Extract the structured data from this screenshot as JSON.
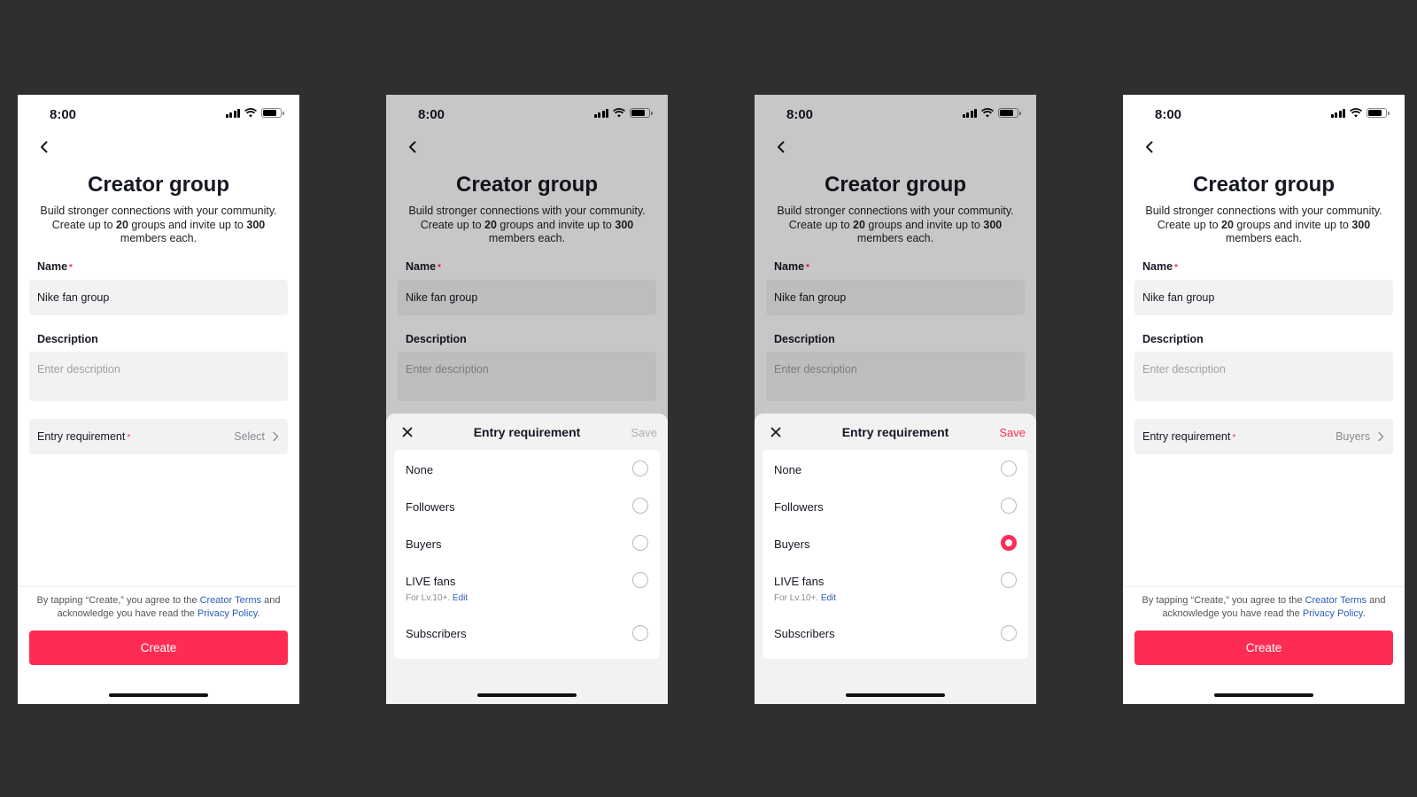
{
  "status_bar": {
    "time": "8:00"
  },
  "page": {
    "title": "Creator group",
    "subtitle_part1": "Build stronger connections with your community. Create up to ",
    "subtitle_groups": "20",
    "subtitle_part2": " groups and invite up to ",
    "subtitle_members": "300",
    "subtitle_part3": " members each.",
    "name_label": "Name",
    "name_value": "Nike fan group",
    "description_label": "Description",
    "description_placeholder": "Enter description",
    "entry_label": "Entry requirement",
    "required_mark": "*"
  },
  "screens": {
    "s1": {
      "entry_value": "Select"
    },
    "s4": {
      "entry_value": "Buyers"
    }
  },
  "footer": {
    "legal_part1": "By tapping “Create,” you agree to the ",
    "creator_terms": "Creator Terms",
    "legal_part2": " and acknowledge you have read the ",
    "privacy_policy": "Privacy Policy",
    "legal_part3": ".",
    "create_label": "Create"
  },
  "sheet": {
    "title": "Entry requirement",
    "save_label": "Save",
    "options": [
      "None",
      "Followers",
      "Buyers",
      "LIVE fans",
      "Subscribers"
    ],
    "live_fans_note": "For Lv.10+. ",
    "edit_label": "Edit",
    "screen3_selected": "Buyers"
  },
  "colors": {
    "accent": "#fe2c55",
    "link": "#2b5db9",
    "background": "#2f2f2f"
  }
}
